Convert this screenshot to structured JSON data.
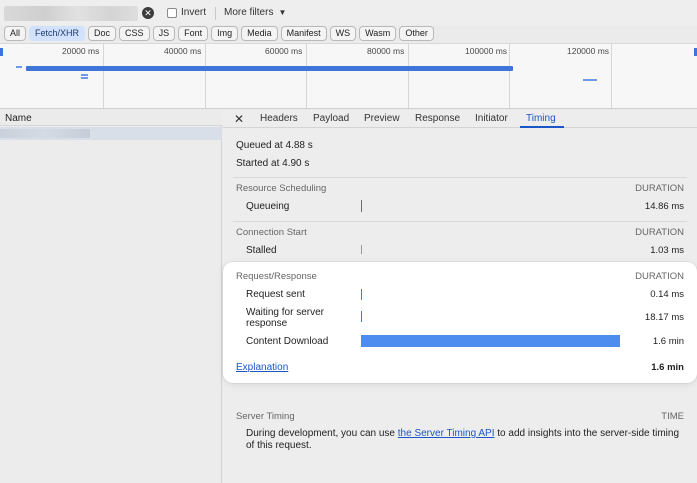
{
  "toolbar": {
    "invert_label": "Invert",
    "more_filters_label": "More filters",
    "filters": [
      {
        "label": "All",
        "active": false
      },
      {
        "label": "Fetch/XHR",
        "active": true
      },
      {
        "label": "Doc",
        "active": false
      },
      {
        "label": "CSS",
        "active": false
      },
      {
        "label": "JS",
        "active": false
      },
      {
        "label": "Font",
        "active": false
      },
      {
        "label": "Img",
        "active": false
      },
      {
        "label": "Media",
        "active": false
      },
      {
        "label": "Manifest",
        "active": false
      },
      {
        "label": "WS",
        "active": false
      },
      {
        "label": "Wasm",
        "active": false
      },
      {
        "label": "Other",
        "active": false
      }
    ]
  },
  "overview": {
    "ticks": [
      "20000 ms",
      "40000 ms",
      "60000 ms",
      "80000 ms",
      "100000 ms",
      "120000 ms"
    ]
  },
  "name_column": {
    "header": "Name"
  },
  "tabs": [
    {
      "label": "Headers",
      "active": false
    },
    {
      "label": "Payload",
      "active": false
    },
    {
      "label": "Preview",
      "active": false
    },
    {
      "label": "Response",
      "active": false
    },
    {
      "label": "Initiator",
      "active": false
    },
    {
      "label": "Timing",
      "active": true
    }
  ],
  "timing": {
    "queued": "Queued at 4.88 s",
    "started": "Started at 4.90 s",
    "resource_scheduling": {
      "title": "Resource Scheduling",
      "duration_header": "DURATION",
      "rows": [
        {
          "label": "Queueing",
          "value": "14.86 ms"
        }
      ]
    },
    "connection_start": {
      "title": "Connection Start",
      "duration_header": "DURATION",
      "rows": [
        {
          "label": "Stalled",
          "value": "1.03 ms"
        }
      ]
    },
    "request_response": {
      "title": "Request/Response",
      "duration_header": "DURATION",
      "rows": [
        {
          "label": "Request sent",
          "value": "0.14 ms"
        },
        {
          "label": "Waiting for server response",
          "value": "18.17 ms"
        },
        {
          "label": "Content Download",
          "value": "1.6 min"
        }
      ],
      "explanation_link": "Explanation",
      "total": "1.6 min"
    },
    "server_timing": {
      "title": "Server Timing",
      "time_header": "TIME",
      "text_before": "During development, you can use ",
      "link": "the Server Timing API",
      "text_after": " to add insights into the server-side timing of this request."
    }
  },
  "colors": {
    "accent": "#1a56c7",
    "bar_fill": "#4e8df0",
    "active_chip": "#d3e2fc"
  }
}
